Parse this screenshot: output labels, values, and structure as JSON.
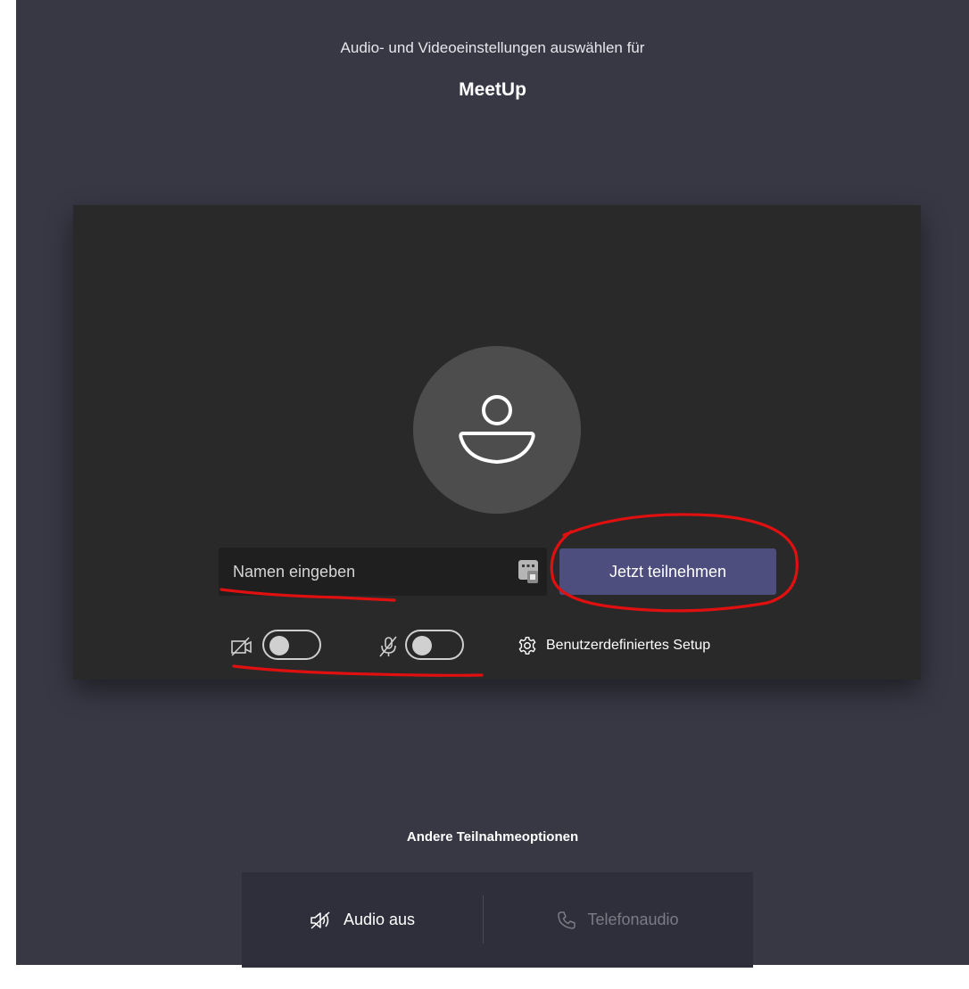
{
  "header": {
    "subtitle": "Audio- und Videoeinstellungen auswählen für",
    "meeting_name": "MeetUp"
  },
  "preview": {
    "avatar_icon": "person-icon",
    "name_input": {
      "value": "",
      "placeholder": "Namen eingeben",
      "icon": "keyboard-icon"
    },
    "join_button_label": "Jetzt teilnehmen",
    "camera": {
      "icon": "camera-off-icon",
      "enabled": false
    },
    "microphone": {
      "icon": "mic-off-icon",
      "enabled": false
    },
    "custom_setup_label": "Benutzerdefiniertes Setup",
    "custom_setup_icon": "gear-icon"
  },
  "other_options": {
    "title": "Andere Teilnahmeoptionen",
    "audio_off_label": "Audio aus",
    "audio_off_icon": "speaker-off-icon",
    "phone_audio_label": "Telefonaudio",
    "phone_audio_icon": "phone-icon"
  },
  "colors": {
    "background": "#383845",
    "preview_panel": "#292929",
    "join_button": "#4d4d7e",
    "annotation": "#e01010"
  }
}
